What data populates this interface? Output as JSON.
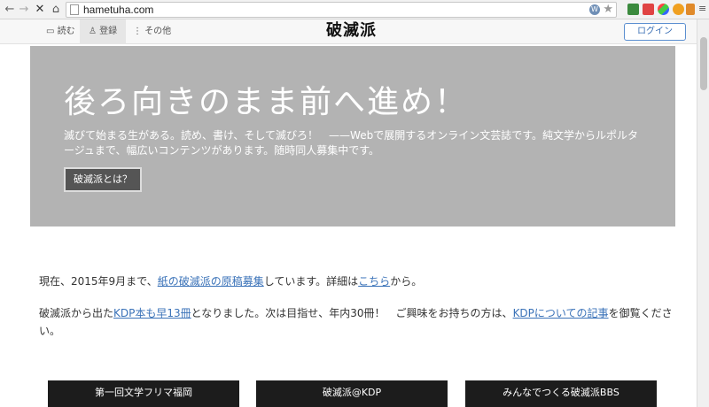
{
  "browser": {
    "url": "hametuha.com",
    "omnibox_w": "W",
    "star_icon": "★"
  },
  "sitenav": {
    "read_label": "読む",
    "register_label": "登録",
    "other_label": "その他",
    "logo": "破滅派",
    "login_label": "ログイン"
  },
  "hero": {
    "title": "後ろ向きのまま前へ進め！",
    "description": "滅びて始まる生がある。読め、書け、そして滅びろ！　——Webで展開するオンライン文芸誌です。純文学からルポルタージュまで、幅広いコンテンツがあります。随時同人募集中です。",
    "button_label": "破滅派とは？"
  },
  "content": {
    "para1": {
      "prefix": "現在、2015年9月まで、",
      "link1": "紙の破滅派の原稿募集",
      "middle": "しています。詳細は",
      "link2": "こちら",
      "suffix": "から。"
    },
    "para2": {
      "prefix": "破滅派から出た",
      "link1": "KDP本も早13冊",
      "middle": "となりました。次は目指せ、年内30冊！　ご興味をお持ちの方は、",
      "link2": "KDPについての記事",
      "suffix": "を御覧ください。"
    }
  },
  "bottom_buttons": [
    {
      "label": "第一回文学フリマ福岡"
    },
    {
      "label": "破滅派@KDP"
    },
    {
      "label": "みんなでつくる破滅派BBS"
    }
  ]
}
